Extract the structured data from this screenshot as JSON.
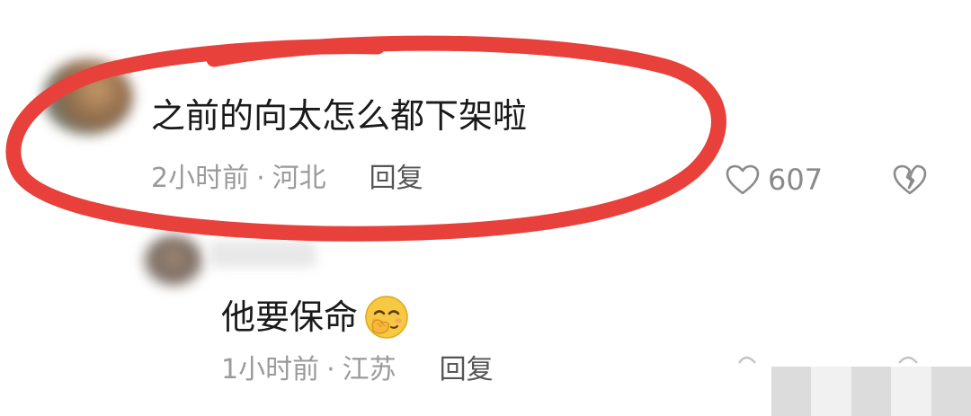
{
  "comments": [
    {
      "text": "之前的向太怎么都下架啦",
      "time": "2小时前",
      "separator": "·",
      "location": "河北",
      "reply_label": "回复",
      "likes": "607",
      "highlighted": true,
      "highlight_color": "#e8403a"
    },
    {
      "text": "他要保命",
      "emoji": "smirking-hand-over-mouth-emoji",
      "time": "1小时前",
      "separator": "·",
      "location": "江苏",
      "reply_label": "回复"
    }
  ],
  "icons": {
    "like": "heart-outline-icon",
    "dislike": "broken-heart-icon"
  },
  "colors": {
    "text": "#1a1a1a",
    "meta": "#9a9a9a",
    "annotation": "#e8403a"
  }
}
